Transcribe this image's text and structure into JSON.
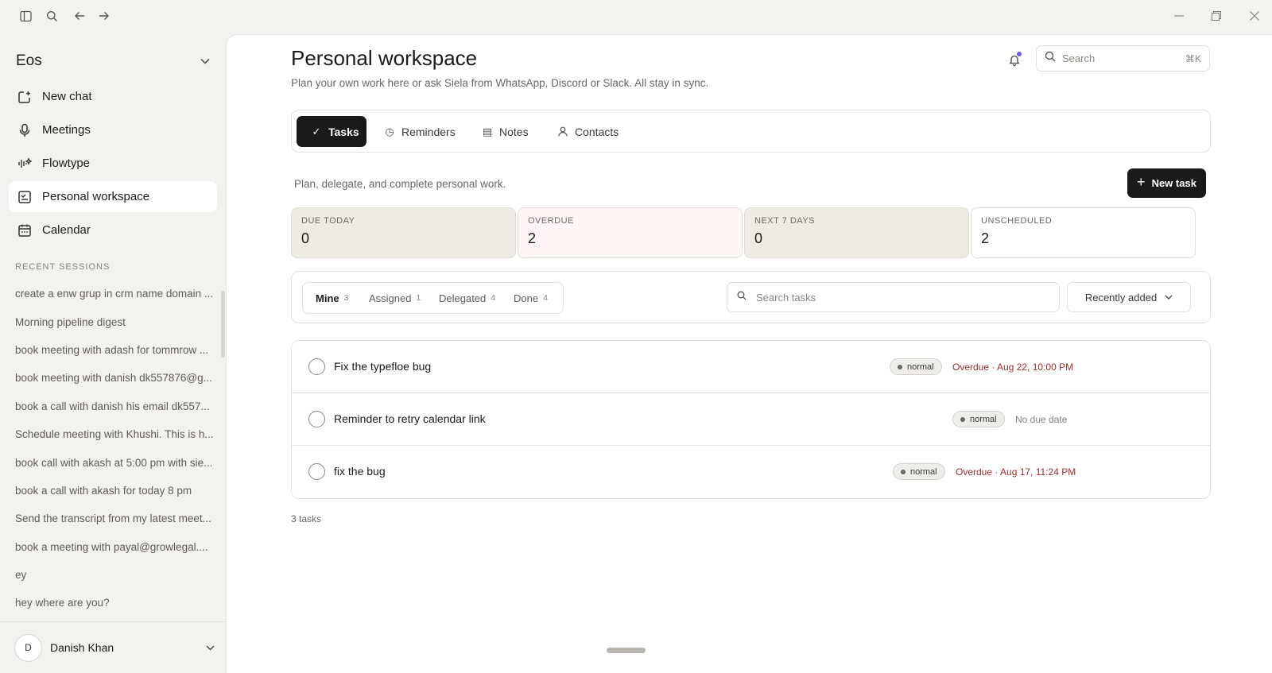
{
  "workspace": {
    "name": "Eos"
  },
  "nav": [
    {
      "label": "New chat",
      "icon": "new-chat-icon"
    },
    {
      "label": "Meetings",
      "icon": "microphone-icon"
    },
    {
      "label": "Flowtype",
      "icon": "waveform-icon"
    },
    {
      "label": "Personal workspace",
      "icon": "workspace-icon",
      "active": true
    },
    {
      "label": "Calendar",
      "icon": "calendar-icon"
    }
  ],
  "recent": {
    "title": "RECENT SESSIONS",
    "items": [
      "create a enw grup in crm name domain ...",
      "Morning pipeline digest",
      "book meeting with adash for tommrow ...",
      "book meeting with danish dk557876@g...",
      "book a call with danish his email dk557...",
      "Schedule meeting with Khushi. This is h...",
      "book call with akash at 5:00 pm with sie...",
      "book a call with akash for today 8 pm",
      "Send the transcript from my latest meet...",
      "book a meeting with payal@growlegal....",
      "ey",
      "hey where are you?"
    ]
  },
  "user": {
    "initial": "D",
    "name": "Danish Khan"
  },
  "page": {
    "title": "Personal workspace",
    "subtitle": "Plan your own work here or ask Siela from WhatsApp, Discord or Slack. All stay in sync."
  },
  "search": {
    "placeholder": "Search",
    "shortcut": "⌘K"
  },
  "tabs": [
    {
      "label": "Tasks",
      "icon": "✓",
      "active": true
    },
    {
      "label": "Reminders",
      "icon": "◷"
    },
    {
      "label": "Notes",
      "icon": "▤"
    },
    {
      "label": "Contacts",
      "icon": "person"
    }
  ],
  "tasks_section": {
    "subtitle": "Plan, delegate, and complete personal work.",
    "new_task_label": "New task"
  },
  "stats": [
    {
      "label": "DUE TODAY",
      "value": "0",
      "bg": "#eeebe4"
    },
    {
      "label": "OVERDUE",
      "value": "2",
      "bg": "#fdf6f4"
    },
    {
      "label": "NEXT 7 DAYS",
      "value": "0",
      "bg": "#eeebe4"
    },
    {
      "label": "UNSCHEDULED",
      "value": "2",
      "bg": "#ffffff"
    }
  ],
  "filters": {
    "segments": [
      {
        "label": "Mine",
        "count": "3",
        "active": true
      },
      {
        "label": "Assigned",
        "count": "1"
      },
      {
        "label": "Delegated",
        "count": "4"
      },
      {
        "label": "Done",
        "count": "4"
      }
    ],
    "search_placeholder": "Search tasks",
    "sort_label": "Recently added"
  },
  "tasks": [
    {
      "title": "Fix the typefloe bug",
      "priority": "normal",
      "due": "Overdue · Aug 22, 10:00 PM",
      "due_state": "overdue"
    },
    {
      "title": "Reminder to retry calendar link",
      "priority": "normal",
      "due": "No due date",
      "due_state": "none"
    },
    {
      "title": "fix the bug",
      "priority": "normal",
      "due": "Overdue · Aug 17, 11:24 PM",
      "due_state": "overdue"
    }
  ],
  "task_count": "3 tasks",
  "colors": {
    "accent": "#1b1a18",
    "overdue": "#9b2f2f",
    "notification": "#6d5ce8"
  }
}
